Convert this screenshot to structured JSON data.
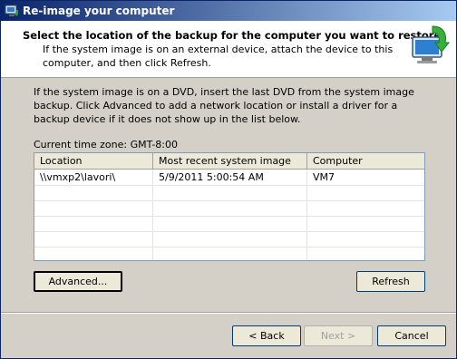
{
  "window": {
    "title": "Re-image your computer"
  },
  "header": {
    "title": "Select the location of the backup for the computer you want to restore",
    "subtitle": "If the system image is on an external device, attach the device to this computer, and then click Refresh."
  },
  "description": "If the system image is on a DVD, insert the last DVD from the system image backup. Click Advanced to add a network location or install a driver for a backup device if it does not show up in the list below.",
  "timezone_label": "Current time zone: GMT-8:00",
  "list": {
    "columns": [
      "Location",
      "Most recent system image",
      "Computer"
    ],
    "rows": [
      [
        "\\\\vmxp2\\lavori\\",
        "5/9/2011 5:00:54 AM",
        "VM7"
      ]
    ]
  },
  "buttons": {
    "advanced": "Advanced...",
    "refresh": "Refresh",
    "back": "< Back",
    "next": "Next >",
    "cancel": "Cancel"
  },
  "colors": {
    "titlebar_start": "#0a246a",
    "titlebar_end": "#a6caf0",
    "dialog_bg": "#d4d0c8"
  },
  "icons": {
    "title": "reimage-app-icon",
    "wizard": "computer-restore-arrow-icon"
  }
}
